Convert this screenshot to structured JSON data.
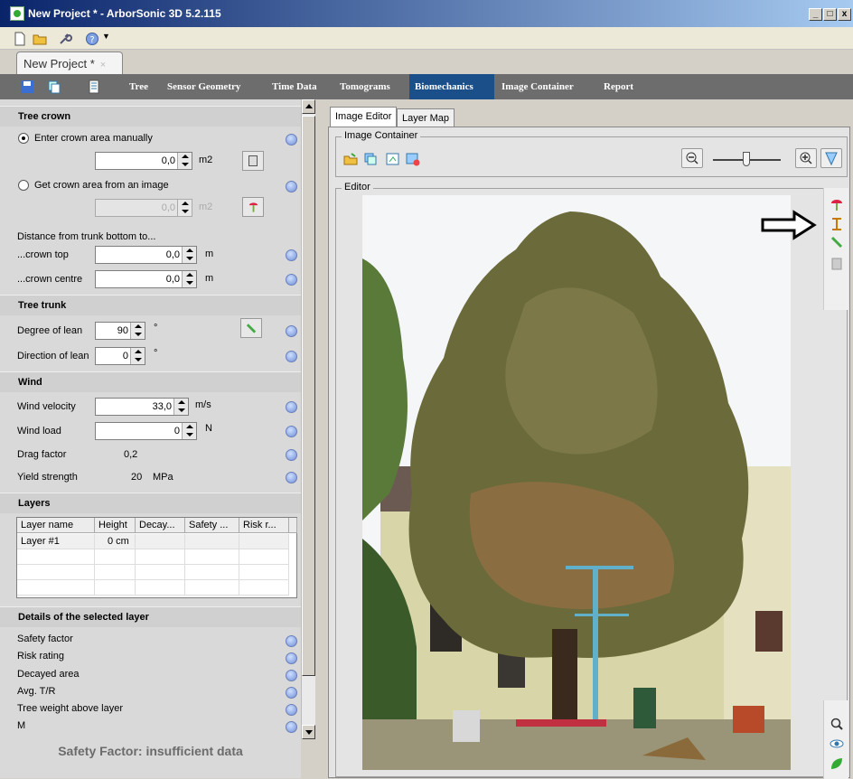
{
  "window": {
    "title": "New Project * - ArborSonic 3D 5.2.115"
  },
  "doc_tab": {
    "label": "New Project *",
    "close": "×"
  },
  "nav": {
    "items": [
      "Tree",
      "Sensor Geometry",
      "Time Data",
      "Tomograms",
      "Biomechanics",
      "Image Container",
      "Report"
    ],
    "active": "Biomechanics"
  },
  "tree_crown": {
    "title": "Tree crown",
    "manual_label": "Enter crown area manually",
    "manual_value": "0,0",
    "manual_unit": "m2",
    "image_label": "Get crown area from an image",
    "image_value": "0,0",
    "image_unit": "m2",
    "distance_label": "Distance from trunk bottom to...",
    "crown_top_label": "...crown top",
    "crown_top_value": "0,0",
    "crown_top_unit": "m",
    "crown_centre_label": "...crown centre",
    "crown_centre_value": "0,0",
    "crown_centre_unit": "m"
  },
  "tree_trunk": {
    "title": "Tree trunk",
    "lean_degree_label": "Degree of lean",
    "lean_degree_value": "90",
    "lean_degree_unit": "°",
    "lean_dir_label": "Direction of lean",
    "lean_dir_value": "0",
    "lean_dir_unit": "°"
  },
  "wind": {
    "title": "Wind",
    "velocity_label": "Wind velocity",
    "velocity_value": "33,0",
    "velocity_unit": "m/s",
    "load_label": "Wind load",
    "load_value": "0",
    "load_unit": "N",
    "drag_label": "Drag factor",
    "drag_value": "0,2",
    "yield_label": "Yield strength",
    "yield_value": "20",
    "yield_unit": "MPa"
  },
  "layers": {
    "title": "Layers",
    "columns": [
      "Layer name",
      "Height",
      "Decay...",
      "Safety ...",
      "Risk r..."
    ],
    "rows": [
      [
        "Layer #1",
        "0 cm",
        "",
        "",
        ""
      ]
    ]
  },
  "details": {
    "title": "Details of the selected layer",
    "items": [
      "Safety factor",
      "Risk rating",
      "Decayed area",
      "Avg. T/R",
      "Tree weight above layer",
      "M"
    ]
  },
  "safety_message": "Safety Factor: insufficient data",
  "right": {
    "tabs": [
      "Image Editor",
      "Layer Map"
    ],
    "image_container_caption": "Image Container",
    "editor_caption": "Editor"
  }
}
